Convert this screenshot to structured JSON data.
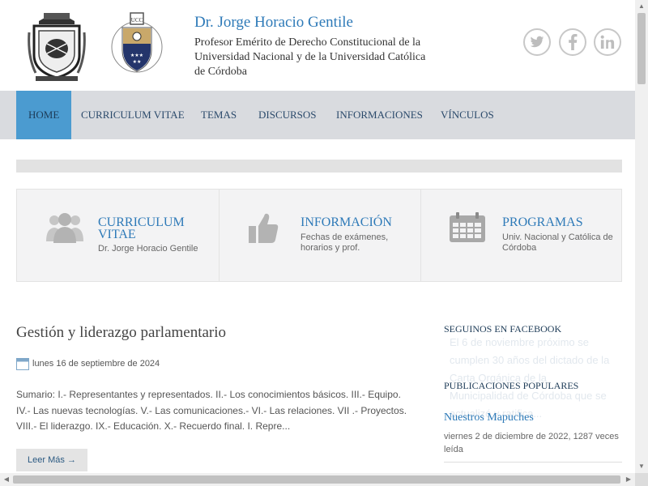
{
  "header": {
    "title": "Dr. Jorge Horacio Gentile",
    "subtitle": "Profesor Emérito de Derecho Constitucional de la Universidad Nacional y de la Universidad Católica de Córdoba",
    "ucc_logo_text": "UCC"
  },
  "social": {
    "twitter": "twitter-icon",
    "facebook": "facebook-icon",
    "linkedin": "linkedin-icon"
  },
  "nav": {
    "items": [
      "HOME",
      "CURRICULUM VITAE",
      "TEMAS",
      "DISCURSOS",
      "INFORMACIONES",
      "VÍNCULOS"
    ],
    "active": "HOME"
  },
  "features": [
    {
      "title": "CURRICULUM VITAE",
      "description": "Dr. Jorge Horacio Gentile",
      "icon": "people-icon"
    },
    {
      "title": "INFORMACIÓN",
      "description": "Fechas de exámenes, horarios y prof.",
      "icon": "thumbs-up-icon"
    },
    {
      "title": "PROGRAMAS",
      "description": "Univ. Nacional y Católica de Córdoba",
      "icon": "calendar-icon"
    }
  ],
  "article": {
    "title": "Gestión y liderazgo parlamentario",
    "date": "lunes 16 de septiembre de 2024",
    "excerpt": "Sumario: I.- Representantes y representados. II.- Los conocimientos básicos. III.- Equipo. IV.- Las nuevas tecnologías. V.- Las comunicaciones.- VI.- Las relaciones. VII .- Proyectos. VIII.- El liderazgo. IX.- Educación.  X.- Recuerdo final. I.                 Repre...",
    "read_more": "Leer Más →"
  },
  "sidebar": {
    "facebook_heading": "SEGUINOS EN FACEBOOK",
    "facebook_ghost_text": "El 6 de noviembre próximo se cumplen 30 años del dictado de la Carta Orgánica de la Municipalidad de Córdoba que se actualizó y ratifica...",
    "popular_heading": "PUBLICACIONES POPULARES",
    "popular_post": {
      "title": "Nuestros Mapuches",
      "meta": "viernes 2 de diciembre de 2022, 1287 veces leída"
    }
  },
  "colors": {
    "accent": "#2e7ab8",
    "nav_bg": "#d9dbdf",
    "nav_active": "#4b9bd0"
  }
}
